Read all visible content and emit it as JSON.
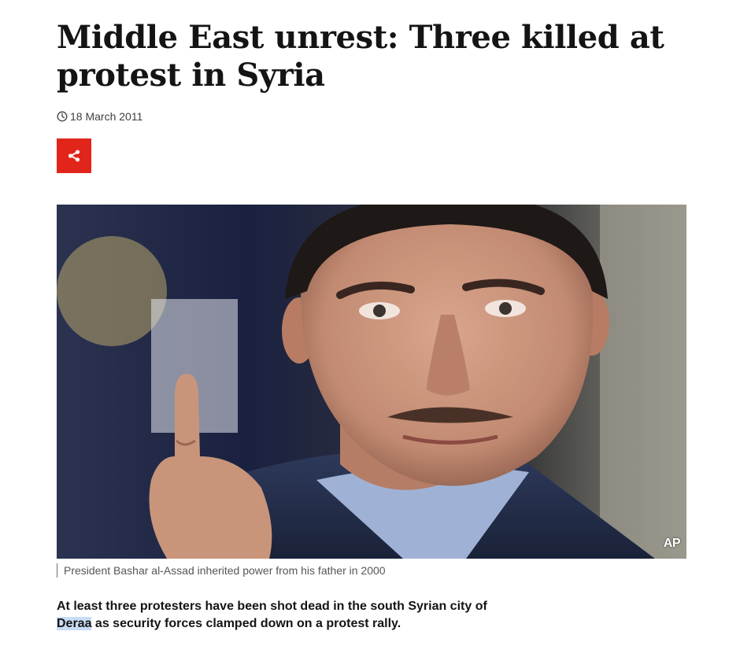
{
  "article": {
    "headline": "Middle East unrest: Three killed at protest in Syria",
    "date": "18 March 2011",
    "share_icon": "share-icon",
    "image": {
      "caption": "President Bashar al-Assad inherited power from his father in 2000",
      "credit": "AP"
    },
    "lede": {
      "before": "At least three protesters have been shot dead in the south Syrian city of ",
      "highlighted": "Deraa",
      "after": " as security forces clamped down on a protest rally."
    }
  },
  "colors": {
    "share_button": "#e2251a",
    "text": "#141414",
    "text_selection": "#c9dcf5"
  }
}
